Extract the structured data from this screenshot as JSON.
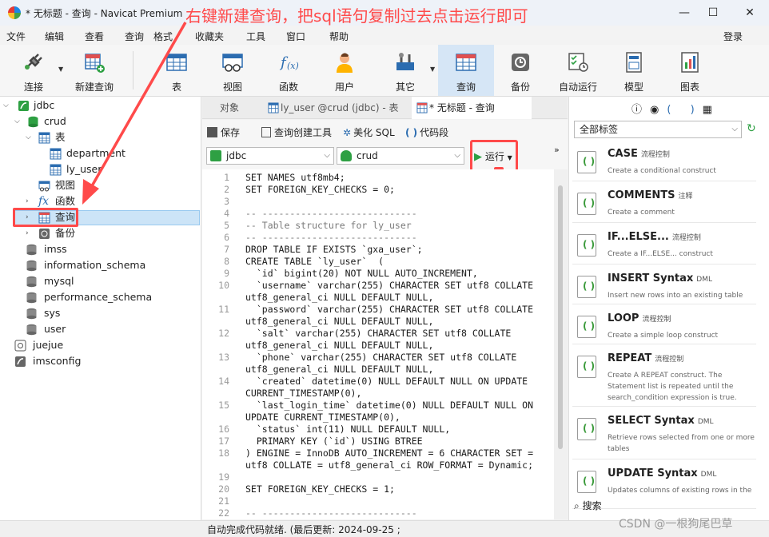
{
  "window": {
    "title": "* 无标题 - 查询 - Navicat Premium",
    "minimize": "—",
    "maximize": "☐",
    "close": "✕"
  },
  "annotation": "右键新建查询，把sql语句复制过去点击运行即可",
  "menu": [
    "文件",
    "编辑",
    "查看",
    "查询",
    "格式",
    "收藏夹",
    "工具",
    "窗口",
    "帮助"
  ],
  "login": "登录",
  "toolbar": [
    {
      "label": "连接",
      "icon": "plug-icon"
    },
    {
      "label": "新建查询",
      "icon": "new-query-icon"
    },
    {
      "label": "表",
      "icon": "table-icon"
    },
    {
      "label": "视图",
      "icon": "view-icon"
    },
    {
      "label": "函数",
      "icon": "function-icon"
    },
    {
      "label": "用户",
      "icon": "user-icon"
    },
    {
      "label": "其它",
      "icon": "tools-icon"
    },
    {
      "label": "查询",
      "icon": "query-icon"
    },
    {
      "label": "备份",
      "icon": "backup-icon"
    },
    {
      "label": "自动运行",
      "icon": "autorun-icon"
    },
    {
      "label": "模型",
      "icon": "model-icon"
    },
    {
      "label": "图表",
      "icon": "chart-icon"
    }
  ],
  "tree": {
    "jdbc": "jdbc",
    "crud": "crud",
    "tables": "表",
    "department": "department",
    "ly_user": "ly_user",
    "views": "视图",
    "functions": "函数",
    "queries": "查询",
    "backups": "备份",
    "dbs": [
      "imss",
      "information_schema",
      "mysql",
      "performance_schema",
      "sys",
      "user"
    ],
    "juejue": "juejue",
    "imsconfig": "imsconfig"
  },
  "tabs": [
    "对象",
    "ly_user @crud (jdbc) - 表",
    "* 无标题 - 查询"
  ],
  "query_toolbar": {
    "save": "保存",
    "builder": "查询创建工具",
    "beautify": "美化 SQL",
    "snippet": "代码段"
  },
  "selectors": {
    "connection": "jdbc",
    "database": "crud",
    "run": "运行"
  },
  "code_lines": [
    {
      "n": "1",
      "t": "SET NAMES utf8mb4;"
    },
    {
      "n": "2",
      "t": "SET FOREIGN_KEY_CHECKS = 0;"
    },
    {
      "n": "3",
      "t": ""
    },
    {
      "n": "4",
      "t": "-- ----------------------------"
    },
    {
      "n": "5",
      "t": "-- Table structure for ly_user"
    },
    {
      "n": "6",
      "t": "-- ----------------------------"
    },
    {
      "n": "7",
      "t": "DROP TABLE IF EXISTS `gxa_user`;"
    },
    {
      "n": "8",
      "t": "CREATE TABLE `ly_user`  ("
    },
    {
      "n": "9",
      "t": "  `id` bigint(20) NOT NULL AUTO_INCREMENT,"
    },
    {
      "n": "10",
      "t": "  `username` varchar(255) CHARACTER SET utf8 COLLATE"
    },
    {
      "n": "",
      "t": "utf8_general_ci NULL DEFAULT NULL,"
    },
    {
      "n": "11",
      "t": "  `password` varchar(255) CHARACTER SET utf8 COLLATE"
    },
    {
      "n": "",
      "t": "utf8_general_ci NULL DEFAULT NULL,"
    },
    {
      "n": "12",
      "t": "  `salt` varchar(255) CHARACTER SET utf8 COLLATE"
    },
    {
      "n": "",
      "t": "utf8_general_ci NULL DEFAULT NULL,"
    },
    {
      "n": "13",
      "t": "  `phone` varchar(255) CHARACTER SET utf8 COLLATE"
    },
    {
      "n": "",
      "t": "utf8_general_ci NULL DEFAULT NULL,"
    },
    {
      "n": "14",
      "t": "  `created` datetime(0) NULL DEFAULT NULL ON UPDATE"
    },
    {
      "n": "",
      "t": "CURRENT_TIMESTAMP(0),"
    },
    {
      "n": "15",
      "t": "  `last_login_time` datetime(0) NULL DEFAULT NULL ON"
    },
    {
      "n": "",
      "t": "UPDATE CURRENT_TIMESTAMP(0),"
    },
    {
      "n": "16",
      "t": "  `status` int(11) NULL DEFAULT NULL,"
    },
    {
      "n": "17",
      "t": "  PRIMARY KEY (`id`) USING BTREE"
    },
    {
      "n": "18",
      "t": ") ENGINE = InnoDB AUTO_INCREMENT = 6 CHARACTER SET ="
    },
    {
      "n": "",
      "t": "utf8 COLLATE = utf8_general_ci ROW_FORMAT = Dynamic;"
    },
    {
      "n": "19",
      "t": ""
    },
    {
      "n": "20",
      "t": "SET FOREIGN_KEY_CHECKS = 1;"
    },
    {
      "n": "21",
      "t": ""
    },
    {
      "n": "22",
      "t": "-- ----------------------------"
    }
  ],
  "right_panel": {
    "tag_filter": "全部标签",
    "search": "搜索",
    "snippets": [
      {
        "title": "CASE",
        "tag": "流程控制",
        "desc": "Create a conditional construct"
      },
      {
        "title": "COMMENTS",
        "tag": "注释",
        "desc": "Create a comment"
      },
      {
        "title": "IF...ELSE...",
        "tag": "流程控制",
        "desc": "Create a IF...ELSE... construct"
      },
      {
        "title": "INSERT Syntax",
        "tag": "DML",
        "desc": "Insert new rows into an existing table"
      },
      {
        "title": "LOOP",
        "tag": "流程控制",
        "desc": "Create a simple loop construct"
      },
      {
        "title": "REPEAT",
        "tag": "流程控制",
        "desc": "Create A REPEAT construct. The Statement list is repeated until the search_condition expression is true."
      },
      {
        "title": "SELECT Syntax",
        "tag": "DML",
        "desc": "Retrieve rows selected from one or more tables"
      },
      {
        "title": "UPDATE Syntax",
        "tag": "DML",
        "desc": "Updates columns of existing rows in the"
      }
    ]
  },
  "status": "自动完成代码就绪. (最后更新: 2024-09-25 ;",
  "watermark": "CSDN @一根狗尾巴草"
}
